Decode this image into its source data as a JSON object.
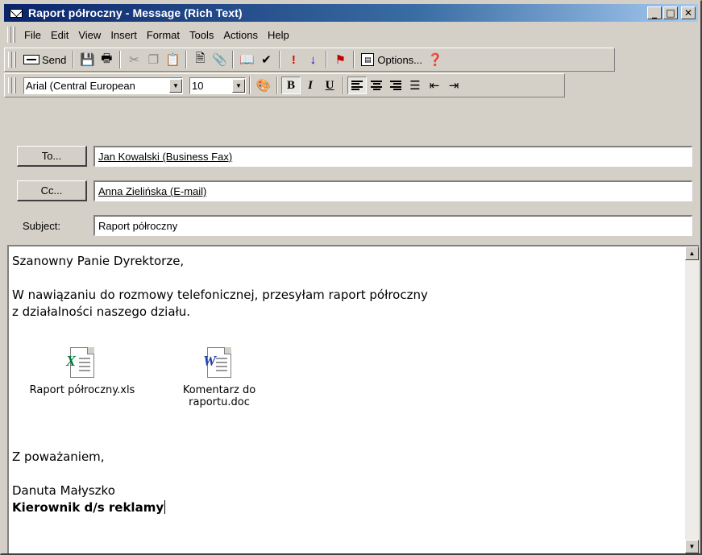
{
  "window": {
    "title": "Raport półroczny - Message (Rich Text)",
    "minimize": "_",
    "maximize": "□",
    "close": "✕"
  },
  "menu": [
    "File",
    "Edit",
    "View",
    "Insert",
    "Format",
    "Tools",
    "Actions",
    "Help"
  ],
  "toolbar": {
    "send_label": "Send",
    "options_label": "Options...",
    "icons": [
      "save-icon",
      "print-icon",
      "cut-icon",
      "copy-icon",
      "paste-icon",
      "insert-file-icon",
      "attach-icon",
      "address-book-icon",
      "check-names-icon",
      "high-importance-icon",
      "low-importance-icon",
      "flag-icon",
      "options-icon",
      "help-icon"
    ]
  },
  "format_toolbar": {
    "font": "Arial (Central European",
    "size": "10",
    "bold": "B",
    "italic": "I",
    "underline": "U"
  },
  "fields": {
    "to_button": "To...",
    "to_value": "Jan Kowalski (Business Fax)",
    "cc_button": "Cc...",
    "cc_value": "Anna Zielińska (E-mail)",
    "subject_label": "Subject:",
    "subject_value": "Raport półroczny"
  },
  "body": {
    "greeting": "Szanowny Panie Dyrektorze,",
    "line1": "W nawiązaniu do rozmowy telefonicznej, przesyłam raport półroczny",
    "line2": "z działalności naszego działu.",
    "closing": "Z poważaniem,",
    "sig_name": "Danuta Małyszko",
    "sig_title": "Kierownik d/s reklamy"
  },
  "attachments": [
    {
      "name": "Raport półroczny.xls",
      "icon": "excel-file-icon",
      "line1": "Raport półroczny.xls",
      "line2": ""
    },
    {
      "name": "Komentarz do raportu.doc",
      "icon": "word-file-icon",
      "line1": "Komentarz do",
      "line2": "raportu.doc"
    }
  ]
}
